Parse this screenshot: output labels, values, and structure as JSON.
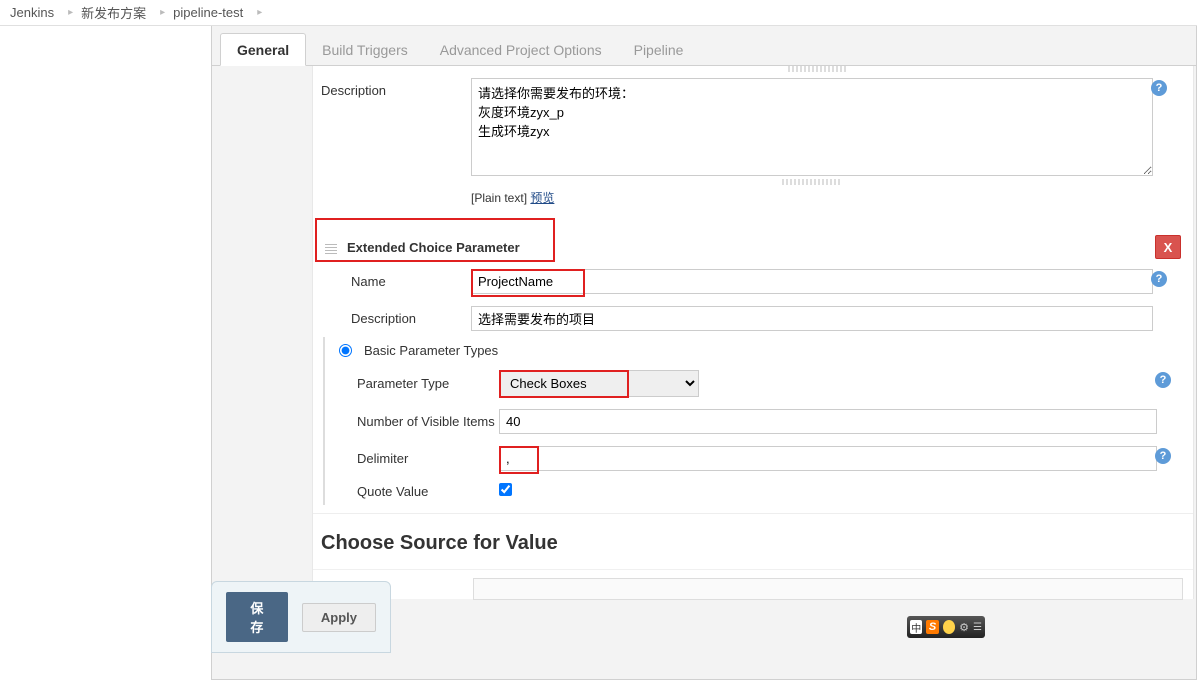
{
  "breadcrumb": {
    "items": [
      "Jenkins",
      "新发布方案",
      "pipeline-test"
    ]
  },
  "tabs": {
    "general": "General",
    "build_triggers": "Build Triggers",
    "advanced": "Advanced Project Options",
    "pipeline": "Pipeline"
  },
  "top_section": {
    "desc_label": "Description",
    "desc_value": "请选择你需要发布的环境：\n灰度环境zyx_p\n生成环境zyx",
    "plain_text": "[Plain text]",
    "preview": "预览"
  },
  "ext_param": {
    "header": "Extended Choice Parameter",
    "delete": "X",
    "name_label": "Name",
    "name_value": "ProjectName",
    "desc_label": "Description",
    "desc_value": "选择需要发布的项目",
    "basic_types": "Basic Parameter Types",
    "param_type_label": "Parameter Type",
    "param_type_value": "Check Boxes",
    "visible_label": "Number of Visible Items",
    "visible_value": "40",
    "delimiter_label": "Delimiter",
    "delimiter_value": ",",
    "quote_label": "Quote Value",
    "quote_checked": true
  },
  "choose_source": {
    "title": "Choose Source for Value"
  },
  "footer": {
    "save": "保存",
    "apply": "Apply"
  },
  "ime": {
    "zh": "中"
  }
}
